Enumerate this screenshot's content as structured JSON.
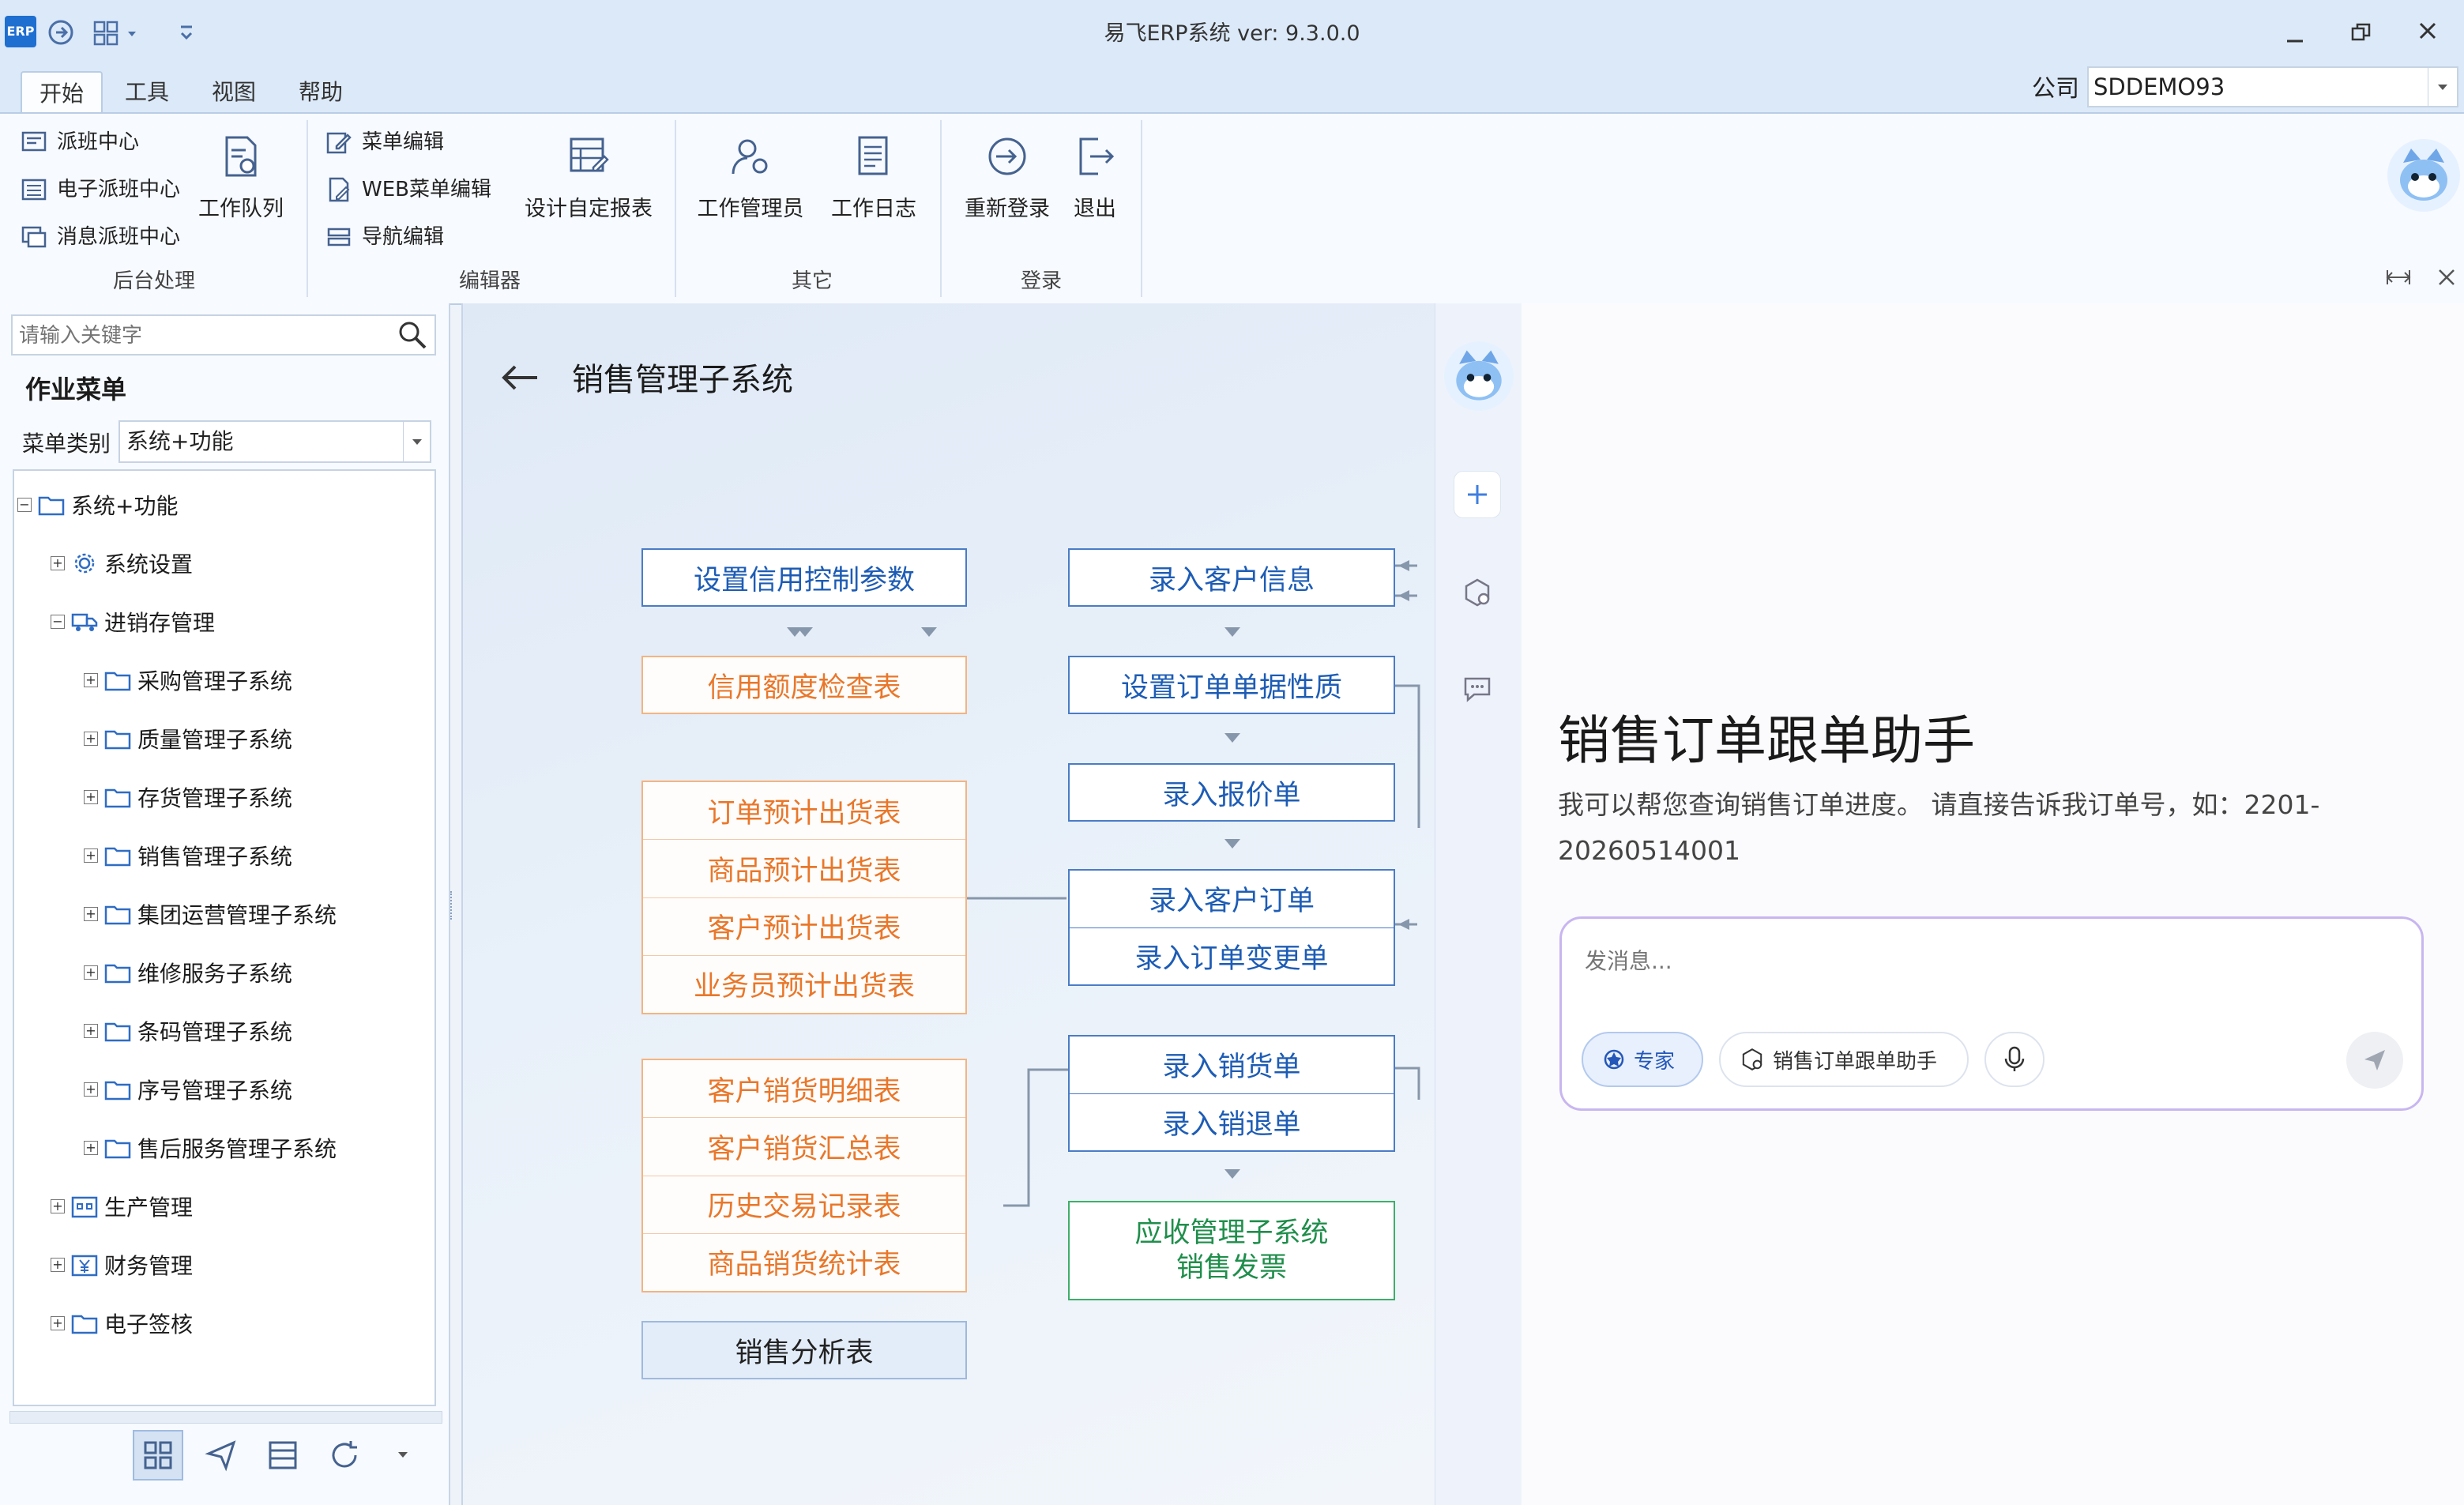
{
  "window": {
    "title": "易飞ERP系统 ver: 9.3.0.0",
    "company_label": "公司",
    "company_value": "SDDEMO93"
  },
  "tabs": [
    "开始",
    "工具",
    "视图",
    "帮助"
  ],
  "ribbon": {
    "groups": {
      "backend": {
        "label": "后台处理",
        "items": [
          "派班中心",
          "电子派班中心",
          "消息派班中心"
        ],
        "big": "工作队列"
      },
      "editor": {
        "label": "编辑器",
        "items": [
          "菜单编辑",
          "WEB菜单编辑",
          "导航编辑"
        ],
        "big": "设计自定报表"
      },
      "other": {
        "label": "其它",
        "big1": "工作管理员",
        "big2": "工作日志"
      },
      "login": {
        "label": "登录",
        "big1": "重新登录",
        "big2": "退出"
      }
    }
  },
  "left": {
    "search_placeholder": "请输入关键字",
    "heading": "作业菜单",
    "category_label": "菜单类别",
    "category_value": "系统+功能",
    "tree": [
      {
        "label": "系统+功能",
        "level": 0,
        "exp": "-",
        "icon": "folder-icon"
      },
      {
        "label": "系统设置",
        "level": 1,
        "exp": "+",
        "icon": "gear-icon"
      },
      {
        "label": "进销存管理",
        "level": 1,
        "exp": "-",
        "icon": "truck-icon"
      },
      {
        "label": "采购管理子系统",
        "level": 2,
        "exp": "+",
        "icon": "folder-icon"
      },
      {
        "label": "质量管理子系统",
        "level": 2,
        "exp": "+",
        "icon": "folder-icon"
      },
      {
        "label": "存货管理子系统",
        "level": 2,
        "exp": "+",
        "icon": "folder-icon"
      },
      {
        "label": "销售管理子系统",
        "level": 2,
        "exp": "+",
        "icon": "folder-icon"
      },
      {
        "label": "集团运营管理子系统",
        "level": 2,
        "exp": "+",
        "icon": "folder-icon"
      },
      {
        "label": "维修服务子系统",
        "level": 2,
        "exp": "+",
        "icon": "folder-icon"
      },
      {
        "label": "条码管理子系统",
        "level": 2,
        "exp": "+",
        "icon": "folder-icon"
      },
      {
        "label": "序号管理子系统",
        "level": 2,
        "exp": "+",
        "icon": "folder-icon"
      },
      {
        "label": "售后服务管理子系统",
        "level": 2,
        "exp": "+",
        "icon": "folder-icon"
      },
      {
        "label": "生产管理",
        "level": 1,
        "exp": "+",
        "icon": "factory-icon"
      },
      {
        "label": "财务管理",
        "level": 1,
        "exp": "+",
        "icon": "yen-icon"
      },
      {
        "label": "电子签核",
        "level": 1,
        "exp": "+",
        "icon": "folder-icon"
      }
    ]
  },
  "flow": {
    "title": "销售管理子系统",
    "credit_param": "设置信用控制参数",
    "credit_check": "信用额度检查表",
    "forecast": [
      "订单预计出货表",
      "商品预计出货表",
      "客户预计出货表",
      "业务员预计出货表"
    ],
    "sales_reports": [
      "客户销货明细表",
      "客户销货汇总表",
      "历史交易记录表",
      "商品销货统计表"
    ],
    "analysis": "销售分析表",
    "customer_info": "录入客户信息",
    "order_nature": "设置订单单据性质",
    "quote": "录入报价单",
    "order_group": [
      "录入客户订单",
      "录入订单变更单"
    ],
    "ship_group": [
      "录入销货单",
      "录入销退单"
    ],
    "ar_group": [
      "应收管理子系统",
      "销售发票"
    ]
  },
  "assistant": {
    "title": "销售订单跟单助手",
    "description": "我可以帮您查询销售订单进度。 请直接告诉我订单号，如：2201-20260514001",
    "input_placeholder": "发消息...",
    "chip_expert": "专家",
    "chip_agent": "销售订单跟单助手"
  }
}
